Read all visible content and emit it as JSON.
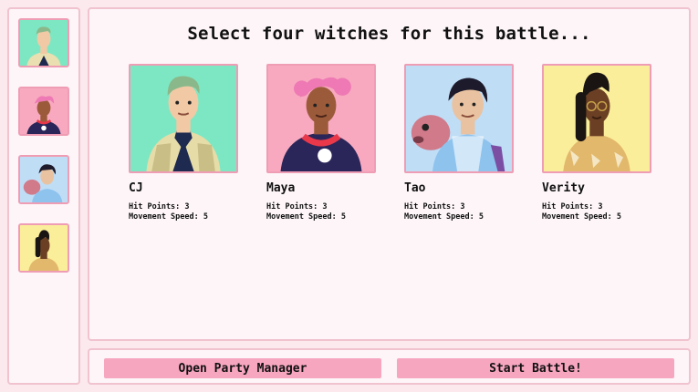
{
  "title": "Select four witches for this battle...",
  "witches": [
    {
      "name": "CJ",
      "hp_label": "Hit Points: 3",
      "speed_label": "Movement Speed: 5",
      "bg": "#7de7c3"
    },
    {
      "name": "Maya",
      "hp_label": "Hit Points: 3",
      "speed_label": "Movement Speed: 5",
      "bg": "#f8a9bf"
    },
    {
      "name": "Tao",
      "hp_label": "Hit Points: 3",
      "speed_label": "Movement Speed: 5",
      "bg": "#c0ddf6"
    },
    {
      "name": "Verity",
      "hp_label": "Hit Points: 3",
      "speed_label": "Movement Speed: 5",
      "bg": "#fbee9a"
    }
  ],
  "buttons": {
    "party_manager": "Open Party Manager",
    "start_battle": "Start Battle!"
  },
  "colors": {
    "accent": "#f7a6c0",
    "border": "#ef9db5",
    "background": "#fbe9ee"
  }
}
